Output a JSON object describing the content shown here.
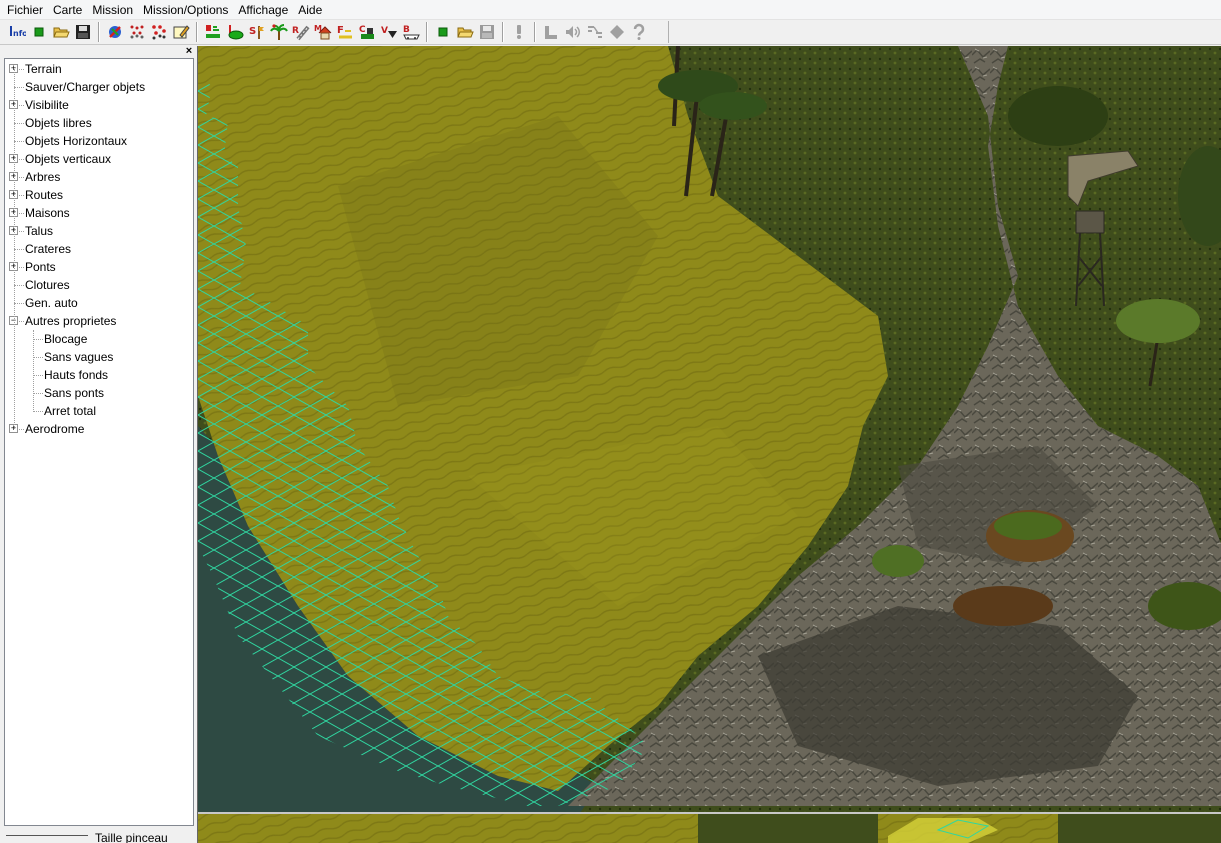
{
  "menu": [
    "Fichier",
    "Carte",
    "Mission",
    "Mission/Options",
    "Affichage",
    "Aide"
  ],
  "toolbar": {
    "info_label": "Info"
  },
  "panel": {
    "close_label": "×",
    "tree": [
      {
        "label": "Terrain",
        "expandable": true,
        "expanded": false
      },
      {
        "label": "Sauver/Charger objets",
        "expandable": false
      },
      {
        "label": "Visibilite",
        "expandable": true,
        "expanded": false
      },
      {
        "label": "Objets libres",
        "expandable": false
      },
      {
        "label": "Objets Horizontaux",
        "expandable": false
      },
      {
        "label": "Objets verticaux",
        "expandable": true,
        "expanded": false
      },
      {
        "label": "Arbres",
        "expandable": true,
        "expanded": false
      },
      {
        "label": "Routes",
        "expandable": true,
        "expanded": false
      },
      {
        "label": "Maisons",
        "expandable": true,
        "expanded": false
      },
      {
        "label": "Talus",
        "expandable": true,
        "expanded": false
      },
      {
        "label": "Crateres",
        "expandable": false
      },
      {
        "label": "Ponts",
        "expandable": true,
        "expanded": false
      },
      {
        "label": "Clotures",
        "expandable": false
      },
      {
        "label": "Gen. auto",
        "expandable": false
      },
      {
        "label": "Autres proprietes",
        "expandable": true,
        "expanded": true,
        "children": [
          "Blocage",
          "Sans vagues",
          "Hauts fonds",
          "Sans ponts",
          "Arret total"
        ]
      },
      {
        "label": "Aerodrome",
        "expandable": true,
        "expanded": false
      }
    ],
    "selected_item": "Hauts fonds",
    "brush_label": "Taille pinceau"
  },
  "colors": {
    "sand": "#8f8a1a",
    "grid": "#2fd6a0",
    "water": "#2f4a3f",
    "rock": "#6b675a"
  }
}
